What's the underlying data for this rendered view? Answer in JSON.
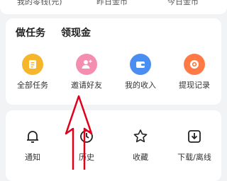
{
  "top_stats": [
    {
      "label": "我的零钱(元)"
    },
    {
      "label": "昨日金币"
    },
    {
      "label": "今日金币"
    }
  ],
  "tasks_card": {
    "title_primary": "做任务",
    "title_secondary": "领现金",
    "items": [
      {
        "label": "全部任务",
        "icon": "task-list-icon",
        "color": "#f6b62c"
      },
      {
        "label": "邀请好友",
        "icon": "invite-friend-icon",
        "color": "#f58db0"
      },
      {
        "label": "我的收入",
        "icon": "wallet-icon",
        "color": "#4a8ef2"
      },
      {
        "label": "提现记录",
        "icon": "withdraw-record-icon",
        "color": "#ff7a45"
      }
    ]
  },
  "tools_card": {
    "items": [
      {
        "label": "通知",
        "icon": "bell-icon"
      },
      {
        "label": "历史",
        "icon": "clock-icon"
      },
      {
        "label": "收藏",
        "icon": "star-icon"
      },
      {
        "label": "下载/离线",
        "icon": "download-icon"
      }
    ]
  },
  "annotation": {
    "color": "#e0001b"
  }
}
